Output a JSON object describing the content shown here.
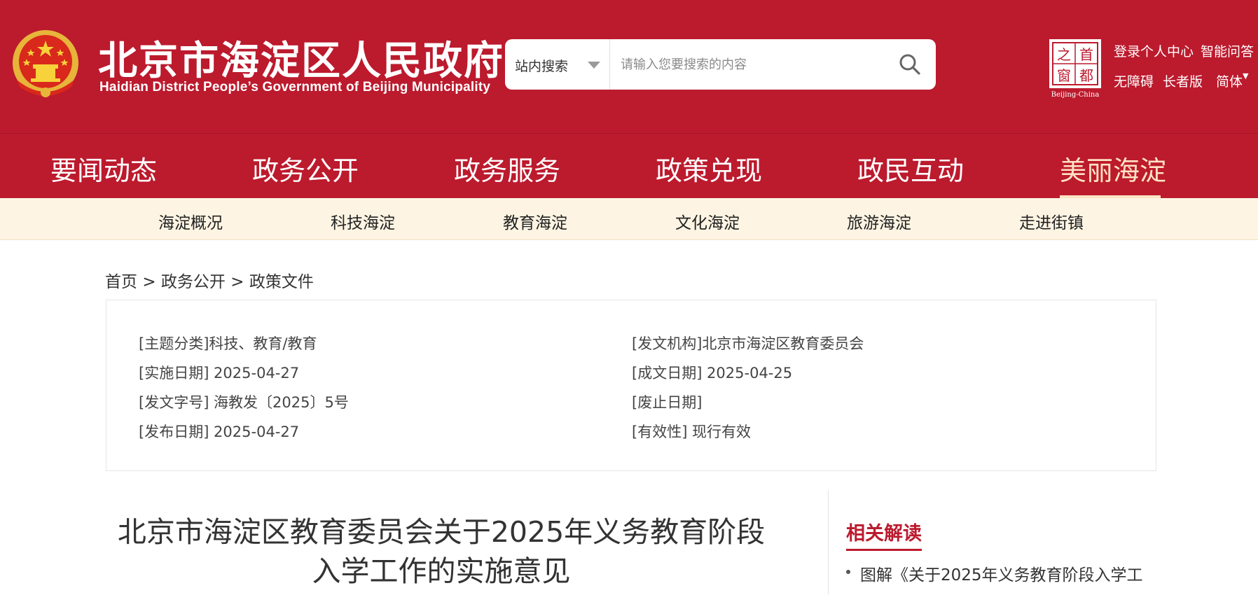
{
  "header": {
    "title_cn": "北京市海淀区人民政府",
    "title_en": "Haidian District People’s Government of Beijing Municipality",
    "search": {
      "scope_label": "站内搜索",
      "placeholder": "请输入您要搜索的内容"
    },
    "capital_logo": {
      "chars": [
        "首",
        "都",
        "之",
        "窗"
      ],
      "caption": "Beijing-China"
    },
    "links": {
      "login": "登录个人中心",
      "smart_qa": "智能问答",
      "accessibility": "无障碍",
      "elderly": "长者版",
      "language": "简体"
    }
  },
  "nav": {
    "items": [
      "要闻动态",
      "政务公开",
      "政务服务",
      "政策兑现",
      "政民互动",
      "美丽海淀"
    ],
    "active_index": 5
  },
  "subnav": {
    "items": [
      "海淀概况",
      "科技海淀",
      "教育海淀",
      "文化海淀",
      "旅游海淀",
      "走进街镇"
    ]
  },
  "breadcrumb": {
    "home": "首页",
    "sep": ">",
    "level1": "政务公开",
    "level2": "政策文件"
  },
  "info": {
    "topic": "[主题分类]科技、教育/教育",
    "issuer": "[发文机构]北京市海淀区教育委员会",
    "effective_date": "[实施日期] 2025-04-27",
    "written_date": "[成文日期] 2025-04-25",
    "doc_number": "[发文字号] 海教发〔2025〕5号",
    "repeal_date": "[废止日期]",
    "publish_date": "[发布日期] 2025-04-27",
    "validity": "[有效性] 现行有效"
  },
  "article": {
    "title_line1": "北京市海淀区教育委员会关于2025年义务教育阶段",
    "title_line2": "入学工作的实施意见"
  },
  "related": {
    "heading": "相关解读",
    "items": [
      "图解《关于2025年义务教育阶段入学工"
    ]
  },
  "colors": {
    "brand_red": "#bc1a2d",
    "subnav_bg": "#fdf4e3",
    "active_nav": "#ffe3c4"
  }
}
